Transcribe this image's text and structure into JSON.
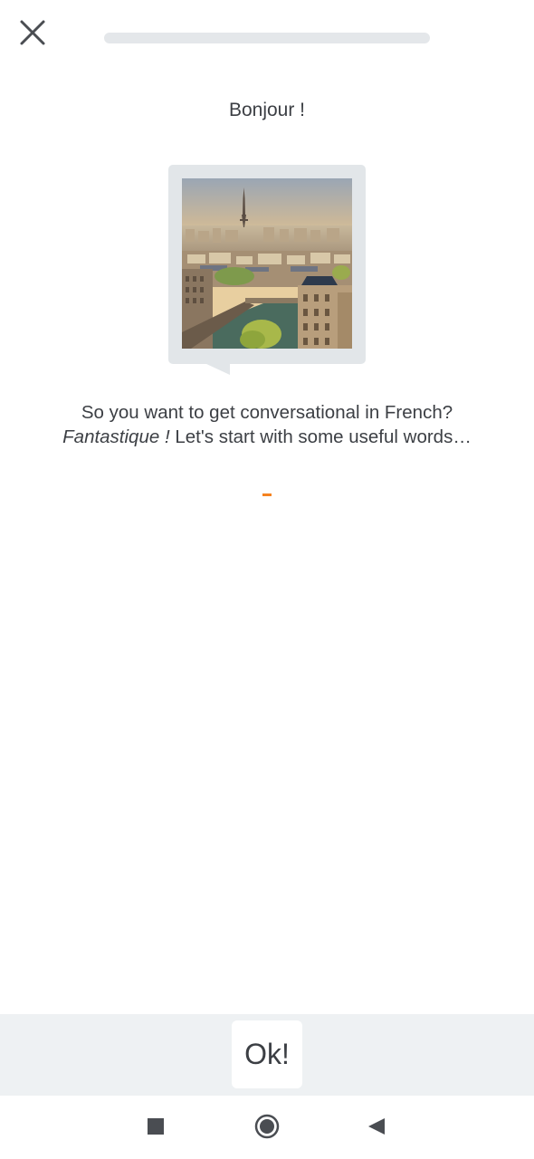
{
  "header": {
    "close_icon": "close-icon",
    "lesson_progress": 0
  },
  "lesson": {
    "greeting": "Bonjour !",
    "image_alt": "Paris skyline with the Eiffel Tower",
    "intro_line1": "So you want to get conversational in French?",
    "intro_emphasis": "Fantastique !",
    "intro_line2_rest": " Let's start with some useful words…"
  },
  "footer": {
    "ok_label": "Ok!"
  },
  "system_nav": {
    "recents_icon": "square-recents-icon",
    "home_icon": "circle-home-icon",
    "back_icon": "triangle-back-icon"
  },
  "colors": {
    "accent": "#f58220",
    "text": "#3c3f44",
    "bubble": "#e2e6e9",
    "footer_bg": "#eef1f3"
  }
}
